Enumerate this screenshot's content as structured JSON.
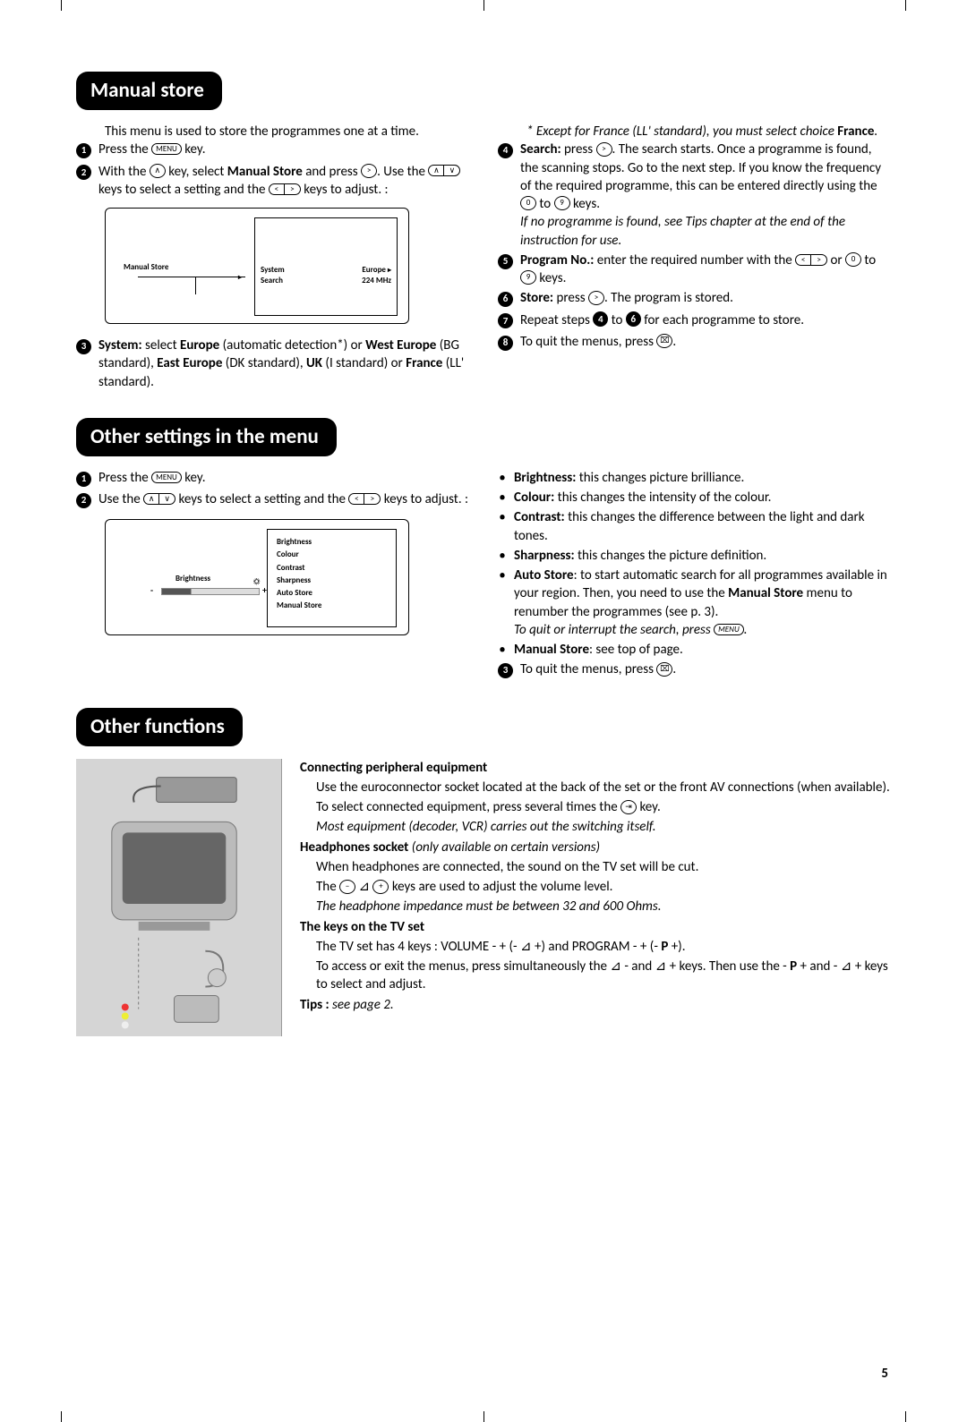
{
  "page_number": "5",
  "manual_store": {
    "heading": "Manual store",
    "intro": "This menu is used to store the programmes one at a time.",
    "step1": "Press the ",
    "step1_key": "MENU",
    "step1_tail": " key.",
    "step2_a": "With the ",
    "step2_b": " key, select ",
    "step2_bold": "Manual Store",
    "step2_c": " and press ",
    "step2_d": ". Use the ",
    "step2_e": " keys to select a setting and the ",
    "step2_f": " keys to adjust. :",
    "screen": {
      "manual_store": "Manual Store",
      "row1_l": "System",
      "row1_r": "Europe",
      "row2_l": "Search",
      "row2_r": "224 MHz"
    },
    "step3_a": "System:",
    "step3_b": " select ",
    "step3_eu": "Europe",
    "step3_auto": " (automatic detection*) or ",
    "step3_we": "West Europe",
    "step3_bg": " (BG standard), ",
    "step3_ee": "East Europe",
    "step3_dk": " (DK standard), ",
    "step3_uk": "UK",
    "step3_i": " (I standard) or ",
    "step3_fr": "France",
    "step3_ll": " (LL' standard).",
    "step3_note_a": "* Except for France (LL' standard), you must select choice ",
    "step3_note_b": "France",
    "step3_note_c": ".",
    "step4_a": "Search:",
    "step4_b": " press ",
    "step4_c": ". The search starts. Once a programme is found, the scanning stops. Go to the next step. If you know the frequency of the required programme, this can be entered directly using the ",
    "step4_d": " to ",
    "step4_e": " keys.",
    "step4_note": "If no programme is found, see Tips chapter at the end of the instruction for use.",
    "step5_a": "Program No.:",
    "step5_b": " enter the required number with the ",
    "step5_c": " or ",
    "step5_d": " to ",
    "step5_e": " keys.",
    "step6_a": "Store:",
    "step6_b": " press ",
    "step6_c": ". The program is stored.",
    "step7_a": "Repeat steps ",
    "step7_b": " to ",
    "step7_c": " for each programme to store.",
    "step8": "To quit the menus, press "
  },
  "other_settings": {
    "heading": "Other settings in the menu",
    "step1_a": "Press the ",
    "step1_key": "MENU",
    "step1_b": " key.",
    "step2_a": "Use the ",
    "step2_b": " keys to select a setting and the ",
    "step2_c": " keys to adjust. :",
    "screen": {
      "left_label": "Brightness",
      "items": [
        "Brightness",
        "Colour",
        "Contrast",
        "Sharpness",
        "Auto Store",
        "Manual Store"
      ]
    },
    "b_brightness_a": "Brightness:",
    "b_brightness_b": " this changes picture brilliance.",
    "b_colour_a": "Colour:",
    "b_colour_b": " this changes the intensity of the colour.",
    "b_contrast_a": "Contrast:",
    "b_contrast_b": " this changes the difference between the light and dark tones.",
    "b_sharp_a": "Sharpness:",
    "b_sharp_b": " this changes the picture definition.",
    "b_auto_a": "Auto Store",
    "b_auto_b": ": to start automatic search for all programmes available in your region. Then, you need to use the ",
    "b_auto_c": "Manual Store",
    "b_auto_d": " menu to renumber the programmes (see p. 3).",
    "b_auto_note_a": "To quit or interrupt the search, press ",
    "b_auto_note_key": "MENU",
    "b_auto_note_b": ".",
    "b_manual_a": "Manual Store",
    "b_manual_b": ": see top of page.",
    "step3": "To quit the menus, press "
  },
  "other_functions": {
    "heading": "Other functions",
    "connecting_h": "Connecting peripheral equipment",
    "connecting_p1": "Use the euroconnector socket located at the back of the set or the front AV connections (when available).",
    "connecting_p2_a": "To select connected equipment, press several times the ",
    "connecting_p2_b": " key.",
    "connecting_note": "Most equipment (decoder, VCR) carries out the switching itself.",
    "headphones_h": "Headphones socket",
    "headphones_hnote": " (only available on certain versions)",
    "headphones_p1": "When headphones are connected, the sound on the TV set will be cut.",
    "headphones_p2_a": "The ",
    "headphones_p2_b": " keys are used to adjust the volume level.",
    "headphones_note": "The headphone impedance must be between 32 and 600 Ohms.",
    "tvkeys_h": "The keys on the TV set",
    "tvkeys_p1_a": "The TV set has 4 keys : VOLUME - + (- ",
    "tvkeys_p1_b": " +) and PROGRAM - + (- ",
    "tvkeys_p1_c": "P",
    "tvkeys_p1_d": " +).",
    "tvkeys_p2_a": "To access or exit the menus, press simultaneously the ",
    "tvkeys_p2_b": " - and ",
    "tvkeys_p2_c": " + keys. Then use the - ",
    "tvkeys_p2_d": "P",
    "tvkeys_p2_e": " + and - ",
    "tvkeys_p2_f": " + keys to select and adjust.",
    "tips_a": "Tips :",
    "tips_b": " see page 2."
  },
  "keys": {
    "up": "∧",
    "down": "∨",
    "left": "<",
    "right": ">",
    "zero": "0",
    "nine": "9",
    "menu": "MENU",
    "exit": "⌧",
    "av": "⇥",
    "minus": "−",
    "plus": "+",
    "vol": "⊿"
  }
}
